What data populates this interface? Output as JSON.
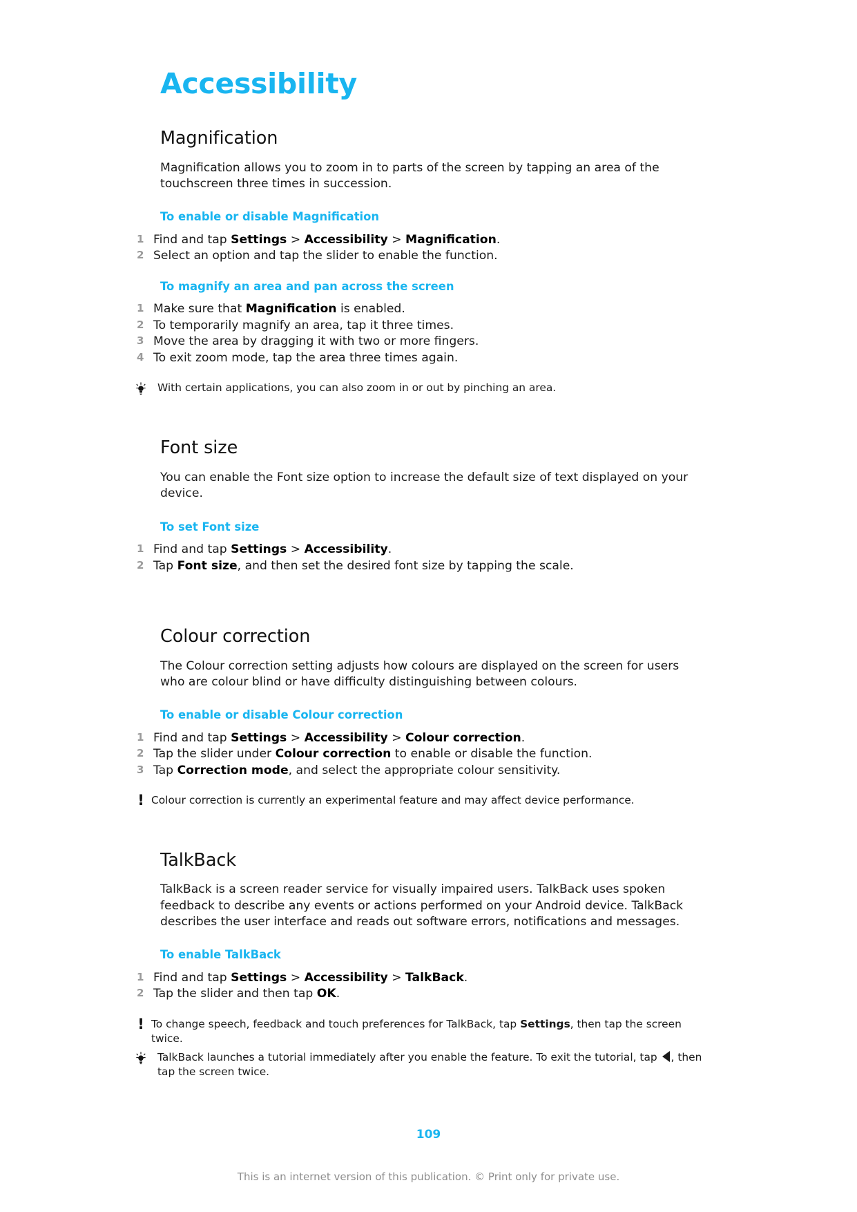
{
  "document": {
    "title": "Accessibility",
    "page_number": "109",
    "footer_note": "This is an internet version of this publication. © Print only for private use.",
    "accent_color": "#19b5f0",
    "text_color": "#1a1a1a",
    "step_number_color": "#9a9a9a"
  },
  "sections": [
    {
      "id": "magnification",
      "heading": "Magnification",
      "body": "Magnification allows you to zoom in to parts of the screen by tapping an area of the touchscreen three times in succession.",
      "procedures": [
        {
          "heading": "To enable or disable Magnification",
          "steps": [
            {
              "num": "1",
              "parts": [
                {
                  "t": "Find and tap ",
                  "b": false
                },
                {
                  "t": "Settings",
                  "b": true
                },
                {
                  "t": " > ",
                  "b": false
                },
                {
                  "t": "Accessibility",
                  "b": true
                },
                {
                  "t": " > ",
                  "b": false
                },
                {
                  "t": "Magnification",
                  "b": true
                },
                {
                  "t": ".",
                  "b": false
                }
              ]
            },
            {
              "num": "2",
              "parts": [
                {
                  "t": "Select an option and tap the slider to enable the function.",
                  "b": false
                }
              ]
            }
          ]
        },
        {
          "heading": "To magnify an area and pan across the screen",
          "steps": [
            {
              "num": "1",
              "parts": [
                {
                  "t": "Make sure that ",
                  "b": false
                },
                {
                  "t": "Magnification",
                  "b": true
                },
                {
                  "t": " is enabled.",
                  "b": false
                }
              ]
            },
            {
              "num": "2",
              "parts": [
                {
                  "t": "To temporarily magnify an area, tap it three times.",
                  "b": false
                }
              ]
            },
            {
              "num": "3",
              "parts": [
                {
                  "t": "Move the area by dragging it with two or more fingers.",
                  "b": false
                }
              ]
            },
            {
              "num": "4",
              "parts": [
                {
                  "t": "To exit zoom mode, tap the area three times again.",
                  "b": false
                }
              ]
            }
          ]
        }
      ],
      "callouts": [
        {
          "type": "tip",
          "icon": "lightbulb-icon",
          "parts": [
            {
              "t": "With certain applications, you can also zoom in or out by pinching an area.",
              "b": false
            }
          ]
        }
      ]
    },
    {
      "id": "font-size",
      "heading": "Font size",
      "body": "You can enable the Font size option to increase the default size of text displayed on your device.",
      "procedures": [
        {
          "heading": "To set Font size",
          "steps": [
            {
              "num": "1",
              "parts": [
                {
                  "t": "Find and tap ",
                  "b": false
                },
                {
                  "t": "Settings",
                  "b": true
                },
                {
                  "t": " > ",
                  "b": false
                },
                {
                  "t": "Accessibility",
                  "b": true
                },
                {
                  "t": ".",
                  "b": false
                }
              ]
            },
            {
              "num": "2",
              "parts": [
                {
                  "t": "Tap ",
                  "b": false
                },
                {
                  "t": "Font size",
                  "b": true
                },
                {
                  "t": ", and then set the desired font size by tapping the scale.",
                  "b": false
                }
              ]
            }
          ]
        }
      ],
      "callouts": []
    },
    {
      "id": "colour-correction",
      "heading": "Colour correction",
      "body": "The Colour correction setting adjusts how colours are displayed on the screen for users who are colour blind or have difficulty distinguishing between colours.",
      "procedures": [
        {
          "heading": "To enable or disable Colour correction",
          "steps": [
            {
              "num": "1",
              "parts": [
                {
                  "t": "Find and tap ",
                  "b": false
                },
                {
                  "t": "Settings",
                  "b": true
                },
                {
                  "t": " > ",
                  "b": false
                },
                {
                  "t": "Accessibility",
                  "b": true
                },
                {
                  "t": " > ",
                  "b": false
                },
                {
                  "t": "Colour correction",
                  "b": true
                },
                {
                  "t": ".",
                  "b": false
                }
              ]
            },
            {
              "num": "2",
              "parts": [
                {
                  "t": "Tap the slider under ",
                  "b": false
                },
                {
                  "t": "Colour correction",
                  "b": true
                },
                {
                  "t": " to enable or disable the function.",
                  "b": false
                }
              ]
            },
            {
              "num": "3",
              "parts": [
                {
                  "t": "Tap ",
                  "b": false
                },
                {
                  "t": "Correction mode",
                  "b": true
                },
                {
                  "t": ", and select the appropriate colour sensitivity.",
                  "b": false
                }
              ]
            }
          ]
        }
      ],
      "callouts": [
        {
          "type": "note",
          "icon": "exclamation-icon",
          "parts": [
            {
              "t": "Colour correction is currently an experimental feature and may affect device performance.",
              "b": false
            }
          ]
        }
      ]
    },
    {
      "id": "talkback",
      "heading": "TalkBack",
      "body": "TalkBack is a screen reader service for visually impaired users. TalkBack uses spoken feedback to describe any events or actions performed on your Android device. TalkBack describes the user interface and reads out software errors, notifications and messages.",
      "procedures": [
        {
          "heading": "To enable TalkBack",
          "steps": [
            {
              "num": "1",
              "parts": [
                {
                  "t": "Find and tap ",
                  "b": false
                },
                {
                  "t": "Settings",
                  "b": true
                },
                {
                  "t": " > ",
                  "b": false
                },
                {
                  "t": "Accessibility",
                  "b": true
                },
                {
                  "t": " > ",
                  "b": false
                },
                {
                  "t": "TalkBack",
                  "b": true
                },
                {
                  "t": ".",
                  "b": false
                }
              ]
            },
            {
              "num": "2",
              "parts": [
                {
                  "t": "Tap the slider and then tap ",
                  "b": false
                },
                {
                  "t": "OK",
                  "b": true
                },
                {
                  "t": ".",
                  "b": false
                }
              ]
            }
          ]
        }
      ],
      "callouts": [
        {
          "type": "note",
          "icon": "exclamation-icon",
          "parts": [
            {
              "t": "To change speech, feedback and touch preferences for TalkBack, tap ",
              "b": false
            },
            {
              "t": "Settings",
              "b": true
            },
            {
              "t": ", then tap the screen twice.",
              "b": false
            }
          ]
        },
        {
          "type": "tip",
          "icon": "lightbulb-icon",
          "parts": [
            {
              "t": "TalkBack launches a tutorial immediately after you enable the feature. To exit the tutorial, tap ",
              "b": false
            },
            {
              "glyph": "back-arrow-icon"
            },
            {
              "t": ", then tap the screen twice.",
              "b": false
            }
          ]
        }
      ]
    }
  ]
}
